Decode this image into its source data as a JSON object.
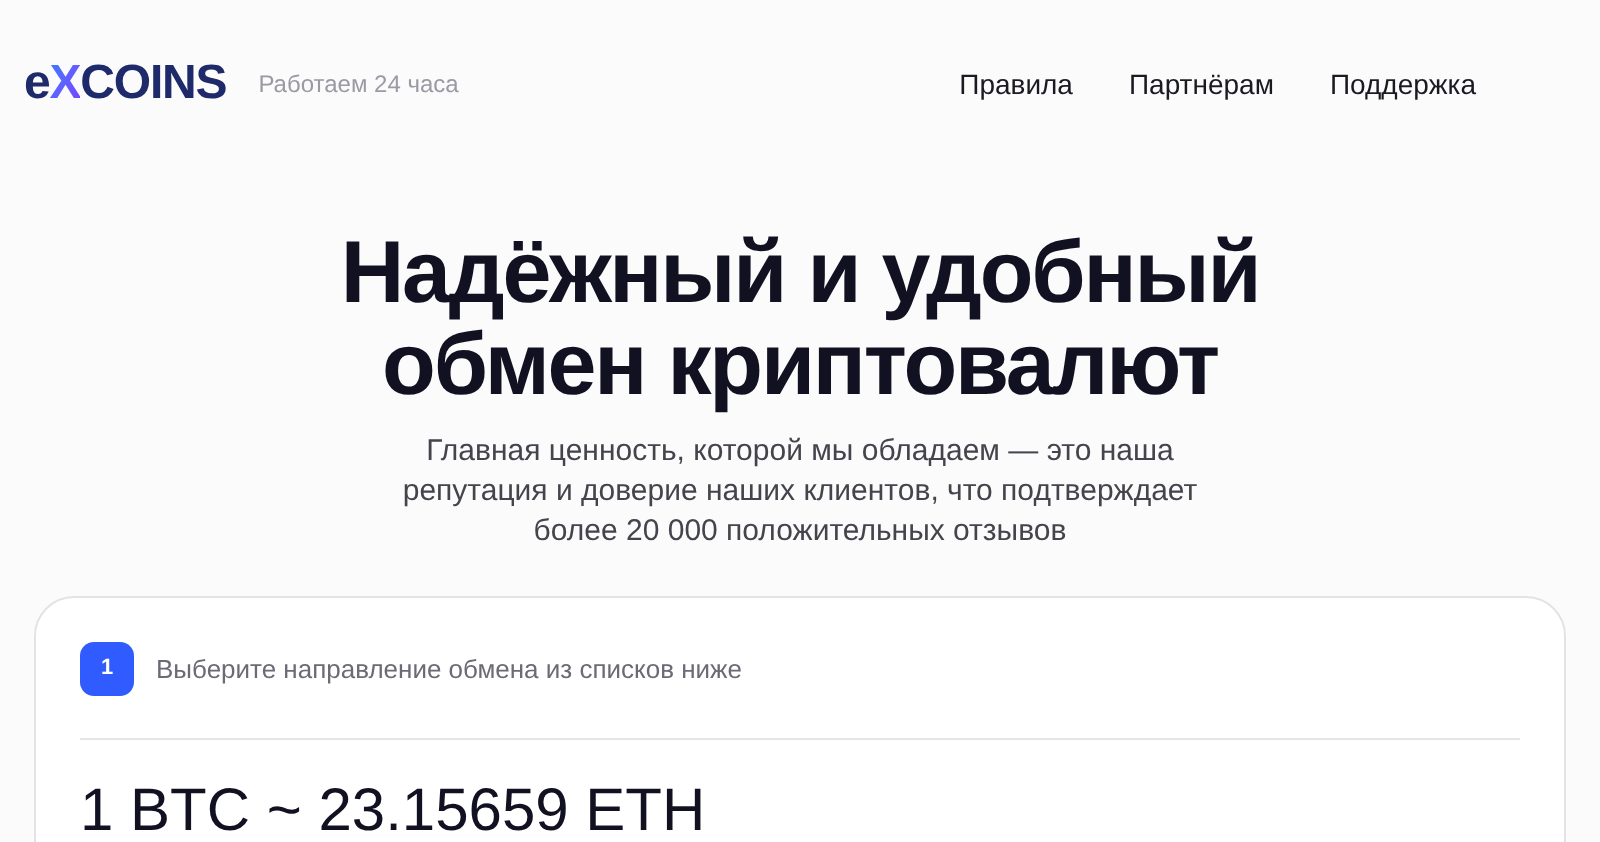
{
  "header": {
    "logo": {
      "lead": "e",
      "mark": "X",
      "rest": "COINS"
    },
    "tagline": "Работаем 24 часа",
    "nav": [
      "Правила",
      "Партнёрам",
      "Поддержка"
    ]
  },
  "hero": {
    "title_lines": [
      "Надёжный и удобный",
      "обмен криптовалют"
    ],
    "subtitle_lines": [
      "Главная ценность, которой мы обладаем — это наша",
      "репутация и доверие наших клиентов, что подтверждает",
      "более 20 000 положительных отзывов"
    ]
  },
  "exchange_card": {
    "step": {
      "number": "1",
      "text": "Выберите направление обмена из списков ниже"
    },
    "rate": "1 BTC ~ 23.15659 ETH"
  }
}
